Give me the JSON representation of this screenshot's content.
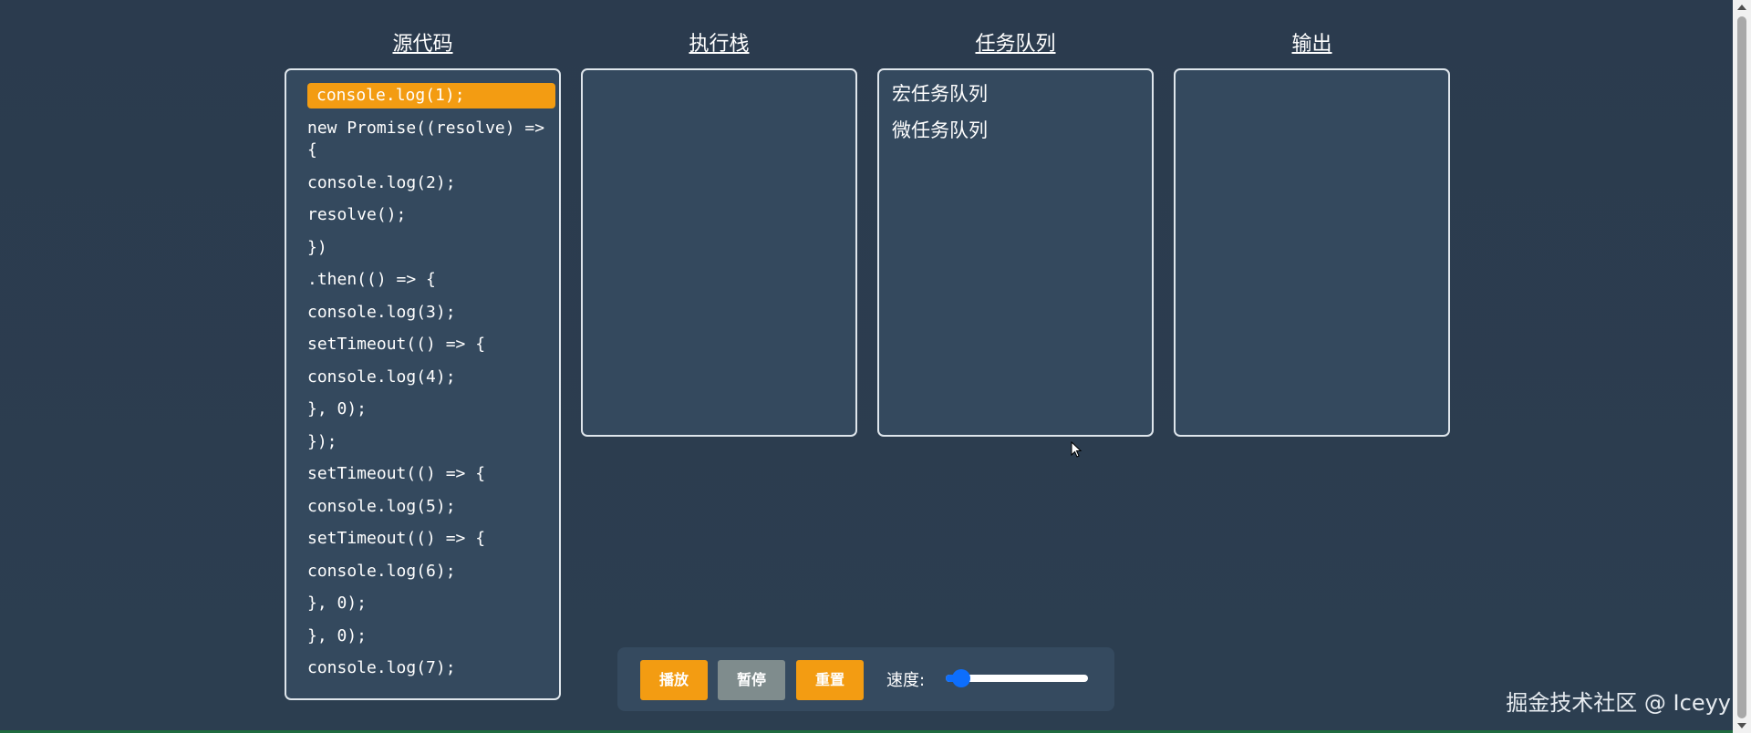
{
  "panels": {
    "source_title": "源代码",
    "stack_title": "执行栈",
    "queue_title": "任务队列",
    "output_title": "输出"
  },
  "code_lines": [
    "console.log(1);",
    "new Promise((resolve) => {",
    "console.log(2);",
    "resolve();",
    "})",
    ".then(() => {",
    "console.log(3);",
    "setTimeout(() => {",
    "console.log(4);",
    "}, 0);",
    "});",
    "setTimeout(() => {",
    "console.log(5);",
    "setTimeout(() => {",
    "console.log(6);",
    "}, 0);",
    "}, 0);",
    "console.log(7);"
  ],
  "queues": {
    "macro_label": "宏任务队列",
    "micro_label": "微任务队列"
  },
  "controls": {
    "play_label": "播放",
    "pause_label": "暂停",
    "reset_label": "重置",
    "speed_label": "速度:",
    "speed_value_fraction": 0.05
  },
  "watermark": "掘金技术社区 @ Iceyy",
  "colors": {
    "background": "#2c3e50",
    "panel": "#34495e",
    "accent": "#f39c12",
    "pause": "#7f8c8d",
    "slider": "#0d6efd"
  }
}
